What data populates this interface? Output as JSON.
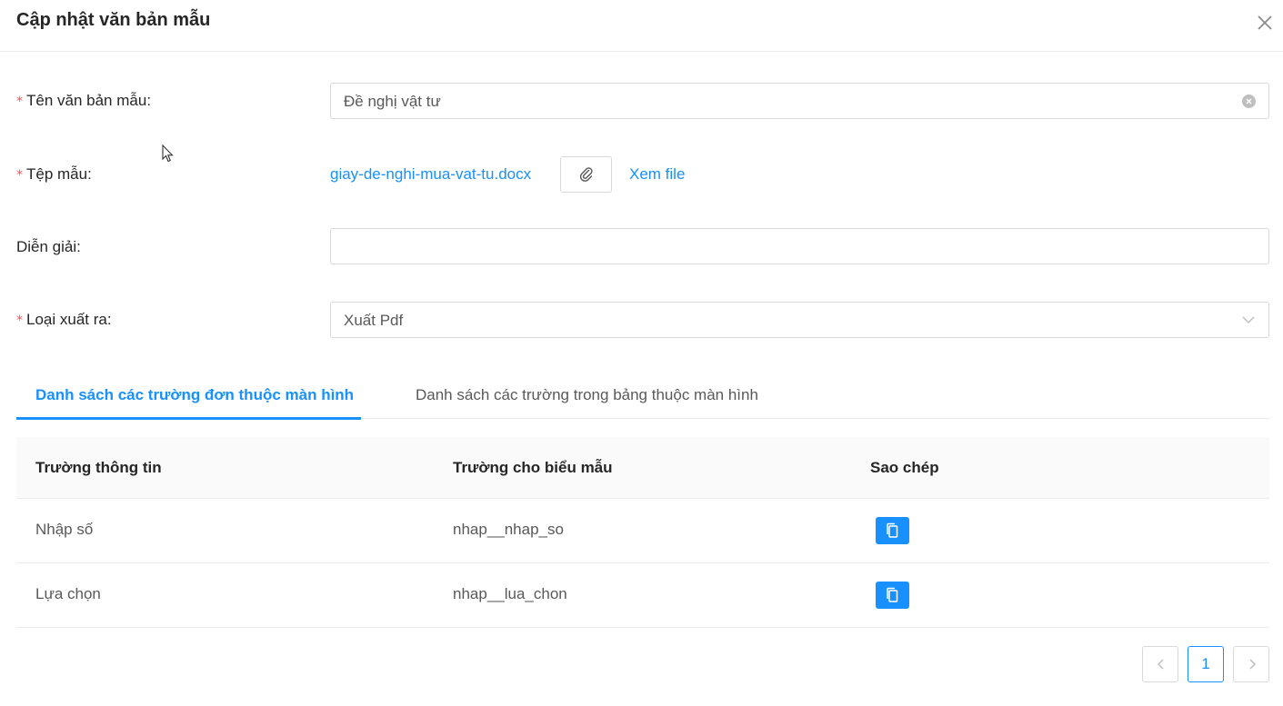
{
  "modal": {
    "title": "Cập nhật văn bản mẫu"
  },
  "form": {
    "name": {
      "label": "Tên văn bản mẫu",
      "colon": ":",
      "value": "Đề nghị vật tư"
    },
    "file": {
      "label": "Tệp mẫu",
      "colon": ":",
      "file_name": "giay-de-nghi-mua-vat-tu.docx",
      "view_label": "Xem file"
    },
    "description": {
      "label": "Diễn giải",
      "colon": ":",
      "value": ""
    },
    "export_type": {
      "label": "Loại xuất ra",
      "colon": ":",
      "value": "Xuất Pdf"
    },
    "required_mark": "*"
  },
  "tabs": [
    {
      "label": "Danh sách các trường đơn thuộc màn hình",
      "active": true
    },
    {
      "label": "Danh sách các trường trong bảng thuộc màn hình",
      "active": false
    }
  ],
  "table": {
    "columns": [
      "Trường thông tin",
      "Trường cho biểu mẫu",
      "Sao chép"
    ],
    "rows": [
      {
        "field": "Nhập số",
        "template_field": "nhap__nhap_so"
      },
      {
        "field": "Lựa chọn",
        "template_field": "nhap__lua_chon"
      }
    ]
  },
  "pagination": {
    "current": "1"
  },
  "colors": {
    "primary": "#1890ff",
    "required": "#ff4d4f",
    "border": "#d9d9d9"
  }
}
